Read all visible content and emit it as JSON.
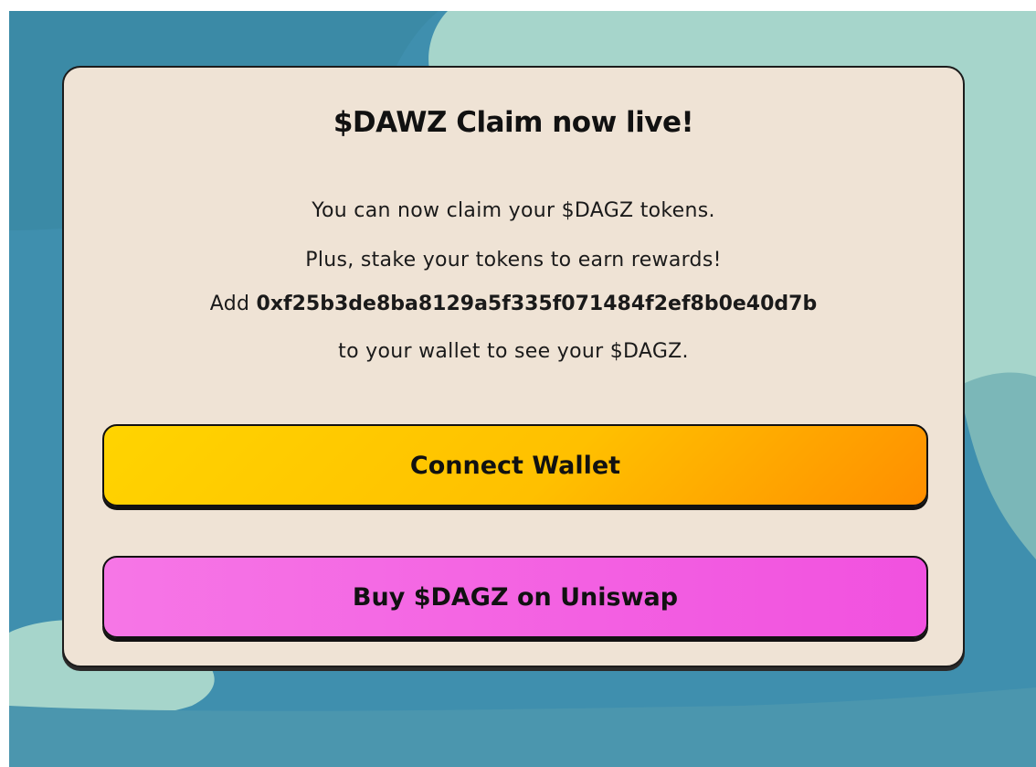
{
  "modal": {
    "title": "$DAWZ Claim now live!",
    "line1": "You can now claim your $DAGZ tokens.",
    "line2": "Plus, stake your tokens to earn rewards!",
    "line3_prefix": "Add",
    "address": "0xf25b3de8ba8129a5f335f071484f2ef8b0e40d7b",
    "line4": "to your wallet to see your $DAGZ."
  },
  "buttons": {
    "connect_label": "Connect Wallet",
    "uniswap_label": "Buy $DAGZ on Uniswap"
  },
  "colors": {
    "card_background": "#efe3d5",
    "connect_gradient_start": "#ffd400",
    "connect_gradient_end": "#ff8f00",
    "uniswap_gradient_start": "#f676e6",
    "uniswap_gradient_end": "#f151df",
    "backdrop_water": "#3f8fae",
    "backdrop_light": "#a6d5cb"
  }
}
